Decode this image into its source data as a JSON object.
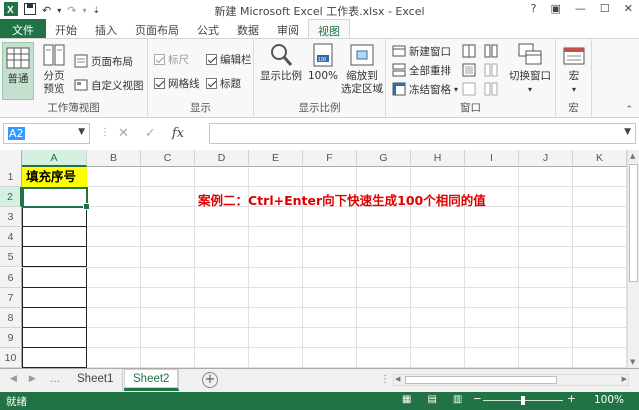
{
  "window": {
    "title": "新建 Microsoft Excel 工作表.xlsx - Excel",
    "controls": [
      "?",
      "▣",
      "—",
      "☐",
      "✕"
    ]
  },
  "tabs": [
    {
      "label": "文件"
    },
    {
      "label": "开始"
    },
    {
      "label": "插入"
    },
    {
      "label": "页面布局"
    },
    {
      "label": "公式"
    },
    {
      "label": "数据"
    },
    {
      "label": "审阅"
    },
    {
      "label": "视图"
    }
  ],
  "ribbon": {
    "workbook_views": {
      "label": "工作簿视图",
      "normal": "普通",
      "page_break_1": "分页",
      "page_break_2": "预览",
      "page_layout": "页面布局",
      "custom_views": "自定义视图"
    },
    "show": {
      "label": "显示",
      "ruler": "标尺",
      "gridlines": "网格线",
      "formula_bar": "编辑栏",
      "headings": "标题"
    },
    "zoom": {
      "label": "显示比例",
      "zoom": "显示比例",
      "hundred": "100%",
      "zoom_sel_1": "缩放到",
      "zoom_sel_2": "选定区域"
    },
    "window": {
      "label": "窗口",
      "new_window": "新建窗口",
      "arrange_all": "全部重排",
      "freeze_panes": "冻结窗格",
      "switch_windows": "切换窗口"
    },
    "macros": {
      "label": "宏",
      "macros": "宏"
    }
  },
  "formula_bar": {
    "name_box": "A2",
    "cancel": "✕",
    "enter": "✓",
    "fx": "fx",
    "value": ""
  },
  "grid": {
    "columns": [
      "A",
      "B",
      "C",
      "D",
      "E",
      "F",
      "G",
      "H",
      "I",
      "J",
      "K"
    ],
    "rows": [
      "1",
      "2",
      "3",
      "4",
      "5",
      "6",
      "7",
      "8",
      "9",
      "10"
    ],
    "cell_a1": "填充序号",
    "note": "案例二：Ctrl+Enter向下快速生成100个相同的值"
  },
  "sheets": {
    "tabs": [
      "Sheet1",
      "Sheet2"
    ],
    "active": "Sheet2",
    "add": "+",
    "dots": "…"
  },
  "status": {
    "text": "就绪",
    "zoom": "100%",
    "zoom_fraction": 0.5
  },
  "colors": {
    "accent": "#217346",
    "highlight": "#ffff00",
    "note": "#e00000"
  }
}
